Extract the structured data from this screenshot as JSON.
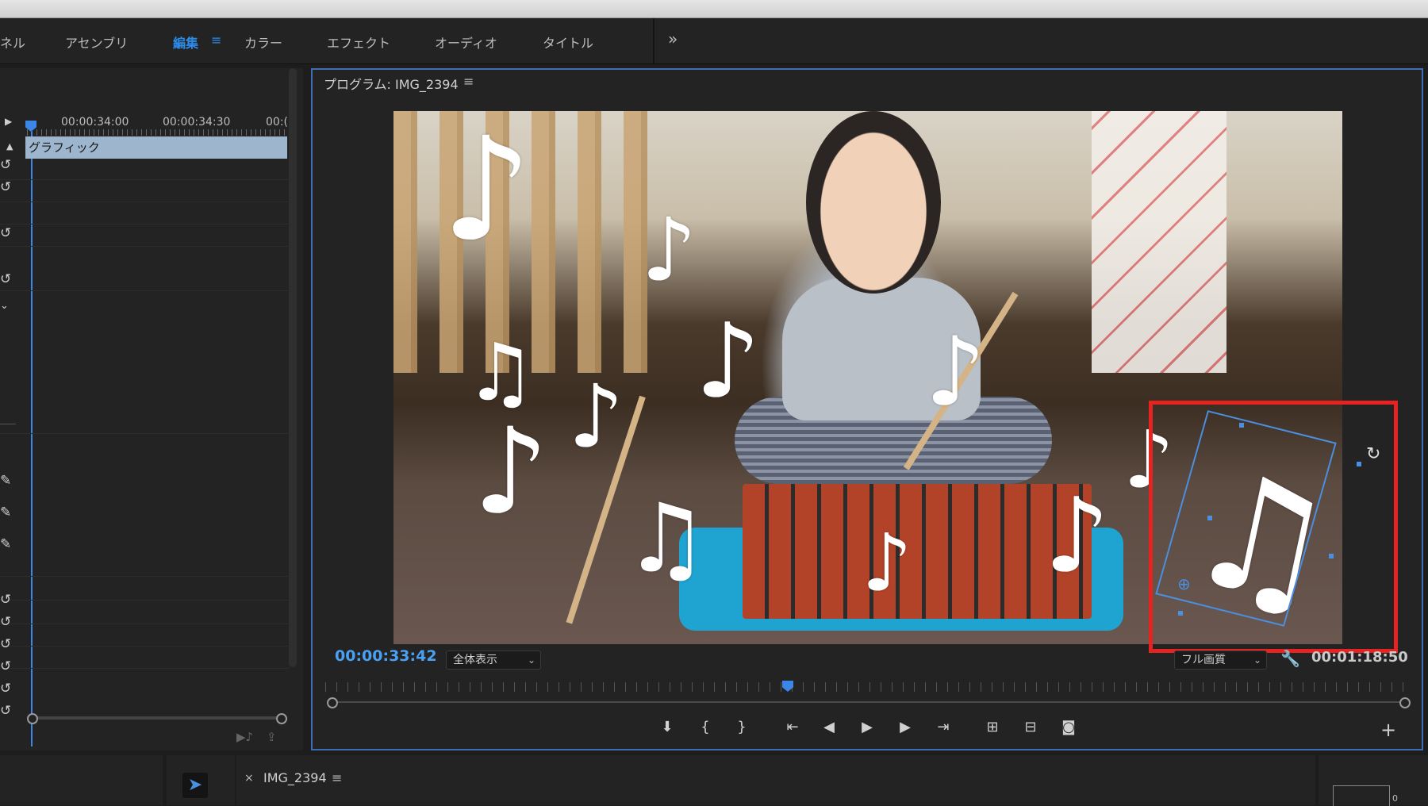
{
  "workspace_tabs": [
    {
      "label": "ネル",
      "active": false
    },
    {
      "label": "アセンブリ",
      "active": false
    },
    {
      "label": "編集",
      "active": true
    },
    {
      "label": "カラー",
      "active": false
    },
    {
      "label": "エフェクト",
      "active": false
    },
    {
      "label": "オーディオ",
      "active": false
    },
    {
      "label": "タイトル",
      "active": false
    }
  ],
  "workspace_more": "»",
  "workspace_menu_icon": "≡",
  "left_panel": {
    "ruler_ticks": [
      "00:00:34:00",
      "00:00:34:30",
      "00:("
    ],
    "graphic_clip_label": "グラフィック"
  },
  "program_monitor": {
    "title": "プログラム: IMG_2394",
    "menu_icon": "≡",
    "current_timecode": "00:00:33:42",
    "zoom_label": "全体表示",
    "quality_label": "フル画質",
    "duration_timecode": "00:01:18:50"
  },
  "transport_buttons": [
    "marker",
    "mark-in",
    "mark-out",
    "go-to-in",
    "step-back",
    "play",
    "step-forward",
    "go-to-out",
    "insert",
    "overwrite",
    "export-frame"
  ],
  "sequence_panel": {
    "close_label": "×",
    "title": "IMG_2394",
    "menu_icon": "≡"
  },
  "meter_zero_label": "0",
  "colors": {
    "accent": "#2d8ceb",
    "selection": "#4b8fe0",
    "highlight_rect": "#e62321",
    "timecode": "#4aa0f2"
  }
}
